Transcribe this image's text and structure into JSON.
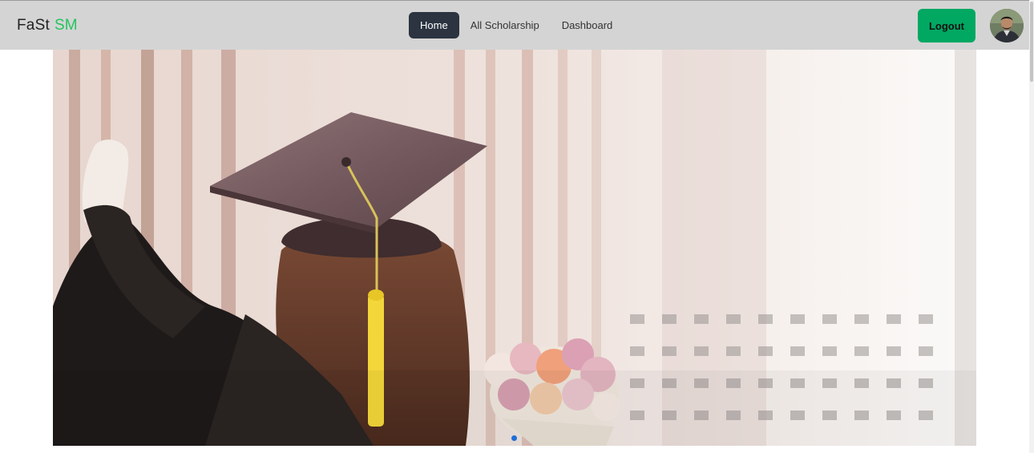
{
  "brand": {
    "name": "FaSt",
    "accent": "SM",
    "accent_color": "#22c55e"
  },
  "nav": {
    "links": [
      {
        "label": "Home",
        "active": true
      },
      {
        "label": "All Scholarship",
        "active": false
      },
      {
        "label": "Dashboard",
        "active": false
      }
    ]
  },
  "header": {
    "logout_label": "Logout",
    "logout_color": "#00a862"
  },
  "carousel": {
    "active_slide": 1,
    "indicator_color": "#1f6fd6"
  }
}
